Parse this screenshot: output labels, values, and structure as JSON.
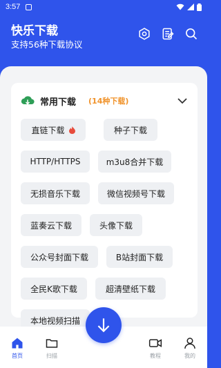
{
  "status_bar": {
    "time": "3:57"
  },
  "app": {
    "title": "快乐下载",
    "subtitle": "支持56种下载协议"
  },
  "header_icons": [
    "settings-gear-icon",
    "notes-icon",
    "search-icon"
  ],
  "card": {
    "title": "常用下载",
    "count": "(14种下载)",
    "icon": "cloud-download-icon"
  },
  "chips": [
    {
      "label": "直链下载",
      "hot": true
    },
    {
      "label": "种子下载"
    },
    {
      "label": "HTTP/HTTPS"
    },
    {
      "label": "m3u8合并下载"
    },
    {
      "label": "无损音乐下载"
    },
    {
      "label": "微信视频号下载"
    },
    {
      "label": "蓝奏云下载"
    },
    {
      "label": "头像下载"
    },
    {
      "label": "公众号封面下载"
    },
    {
      "label": "B站封面下载"
    },
    {
      "label": "全民K歌下载"
    },
    {
      "label": "超清壁纸下载"
    },
    {
      "label": "本地视频扫描"
    }
  ],
  "bottom_nav": {
    "items": [
      {
        "label": "首页",
        "icon": "home-icon",
        "active": true
      },
      {
        "label": "扫描",
        "icon": "folder-icon"
      },
      {
        "label": "教程",
        "icon": "video-camera-icon"
      },
      {
        "label": "我的",
        "icon": "user-icon"
      }
    ],
    "fab_icon": "download-arrow-icon"
  },
  "colors": {
    "primary": "#2f54eb",
    "count_orange": "#f0932b",
    "chip_bg": "#eef0f3",
    "panel_bg": "#f3f4f6",
    "hot_red": "#e74c3c",
    "cloud_green": "#2e9e57"
  }
}
